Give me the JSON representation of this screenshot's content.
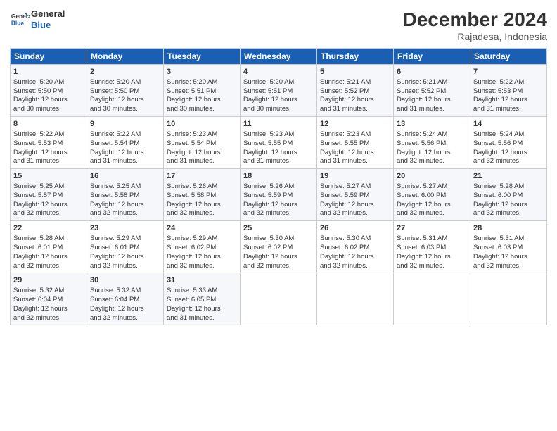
{
  "header": {
    "logo_line1": "General",
    "logo_line2": "Blue",
    "main_title": "December 2024",
    "subtitle": "Rajadesa, Indonesia"
  },
  "weekdays": [
    "Sunday",
    "Monday",
    "Tuesday",
    "Wednesday",
    "Thursday",
    "Friday",
    "Saturday"
  ],
  "weeks": [
    [
      {
        "day": "1",
        "lines": [
          "Sunrise: 5:20 AM",
          "Sunset: 5:50 PM",
          "Daylight: 12 hours",
          "and 30 minutes."
        ]
      },
      {
        "day": "2",
        "lines": [
          "Sunrise: 5:20 AM",
          "Sunset: 5:50 PM",
          "Daylight: 12 hours",
          "and 30 minutes."
        ]
      },
      {
        "day": "3",
        "lines": [
          "Sunrise: 5:20 AM",
          "Sunset: 5:51 PM",
          "Daylight: 12 hours",
          "and 30 minutes."
        ]
      },
      {
        "day": "4",
        "lines": [
          "Sunrise: 5:20 AM",
          "Sunset: 5:51 PM",
          "Daylight: 12 hours",
          "and 30 minutes."
        ]
      },
      {
        "day": "5",
        "lines": [
          "Sunrise: 5:21 AM",
          "Sunset: 5:52 PM",
          "Daylight: 12 hours",
          "and 31 minutes."
        ]
      },
      {
        "day": "6",
        "lines": [
          "Sunrise: 5:21 AM",
          "Sunset: 5:52 PM",
          "Daylight: 12 hours",
          "and 31 minutes."
        ]
      },
      {
        "day": "7",
        "lines": [
          "Sunrise: 5:22 AM",
          "Sunset: 5:53 PM",
          "Daylight: 12 hours",
          "and 31 minutes."
        ]
      }
    ],
    [
      {
        "day": "8",
        "lines": [
          "Sunrise: 5:22 AM",
          "Sunset: 5:53 PM",
          "Daylight: 12 hours",
          "and 31 minutes."
        ]
      },
      {
        "day": "9",
        "lines": [
          "Sunrise: 5:22 AM",
          "Sunset: 5:54 PM",
          "Daylight: 12 hours",
          "and 31 minutes."
        ]
      },
      {
        "day": "10",
        "lines": [
          "Sunrise: 5:23 AM",
          "Sunset: 5:54 PM",
          "Daylight: 12 hours",
          "and 31 minutes."
        ]
      },
      {
        "day": "11",
        "lines": [
          "Sunrise: 5:23 AM",
          "Sunset: 5:55 PM",
          "Daylight: 12 hours",
          "and 31 minutes."
        ]
      },
      {
        "day": "12",
        "lines": [
          "Sunrise: 5:23 AM",
          "Sunset: 5:55 PM",
          "Daylight: 12 hours",
          "and 31 minutes."
        ]
      },
      {
        "day": "13",
        "lines": [
          "Sunrise: 5:24 AM",
          "Sunset: 5:56 PM",
          "Daylight: 12 hours",
          "and 32 minutes."
        ]
      },
      {
        "day": "14",
        "lines": [
          "Sunrise: 5:24 AM",
          "Sunset: 5:56 PM",
          "Daylight: 12 hours",
          "and 32 minutes."
        ]
      }
    ],
    [
      {
        "day": "15",
        "lines": [
          "Sunrise: 5:25 AM",
          "Sunset: 5:57 PM",
          "Daylight: 12 hours",
          "and 32 minutes."
        ]
      },
      {
        "day": "16",
        "lines": [
          "Sunrise: 5:25 AM",
          "Sunset: 5:58 PM",
          "Daylight: 12 hours",
          "and 32 minutes."
        ]
      },
      {
        "day": "17",
        "lines": [
          "Sunrise: 5:26 AM",
          "Sunset: 5:58 PM",
          "Daylight: 12 hours",
          "and 32 minutes."
        ]
      },
      {
        "day": "18",
        "lines": [
          "Sunrise: 5:26 AM",
          "Sunset: 5:59 PM",
          "Daylight: 12 hours",
          "and 32 minutes."
        ]
      },
      {
        "day": "19",
        "lines": [
          "Sunrise: 5:27 AM",
          "Sunset: 5:59 PM",
          "Daylight: 12 hours",
          "and 32 minutes."
        ]
      },
      {
        "day": "20",
        "lines": [
          "Sunrise: 5:27 AM",
          "Sunset: 6:00 PM",
          "Daylight: 12 hours",
          "and 32 minutes."
        ]
      },
      {
        "day": "21",
        "lines": [
          "Sunrise: 5:28 AM",
          "Sunset: 6:00 PM",
          "Daylight: 12 hours",
          "and 32 minutes."
        ]
      }
    ],
    [
      {
        "day": "22",
        "lines": [
          "Sunrise: 5:28 AM",
          "Sunset: 6:01 PM",
          "Daylight: 12 hours",
          "and 32 minutes."
        ]
      },
      {
        "day": "23",
        "lines": [
          "Sunrise: 5:29 AM",
          "Sunset: 6:01 PM",
          "Daylight: 12 hours",
          "and 32 minutes."
        ]
      },
      {
        "day": "24",
        "lines": [
          "Sunrise: 5:29 AM",
          "Sunset: 6:02 PM",
          "Daylight: 12 hours",
          "and 32 minutes."
        ]
      },
      {
        "day": "25",
        "lines": [
          "Sunrise: 5:30 AM",
          "Sunset: 6:02 PM",
          "Daylight: 12 hours",
          "and 32 minutes."
        ]
      },
      {
        "day": "26",
        "lines": [
          "Sunrise: 5:30 AM",
          "Sunset: 6:02 PM",
          "Daylight: 12 hours",
          "and 32 minutes."
        ]
      },
      {
        "day": "27",
        "lines": [
          "Sunrise: 5:31 AM",
          "Sunset: 6:03 PM",
          "Daylight: 12 hours",
          "and 32 minutes."
        ]
      },
      {
        "day": "28",
        "lines": [
          "Sunrise: 5:31 AM",
          "Sunset: 6:03 PM",
          "Daylight: 12 hours",
          "and 32 minutes."
        ]
      }
    ],
    [
      {
        "day": "29",
        "lines": [
          "Sunrise: 5:32 AM",
          "Sunset: 6:04 PM",
          "Daylight: 12 hours",
          "and 32 minutes."
        ]
      },
      {
        "day": "30",
        "lines": [
          "Sunrise: 5:32 AM",
          "Sunset: 6:04 PM",
          "Daylight: 12 hours",
          "and 32 minutes."
        ]
      },
      {
        "day": "31",
        "lines": [
          "Sunrise: 5:33 AM",
          "Sunset: 6:05 PM",
          "Daylight: 12 hours",
          "and 31 minutes."
        ]
      },
      null,
      null,
      null,
      null
    ]
  ]
}
